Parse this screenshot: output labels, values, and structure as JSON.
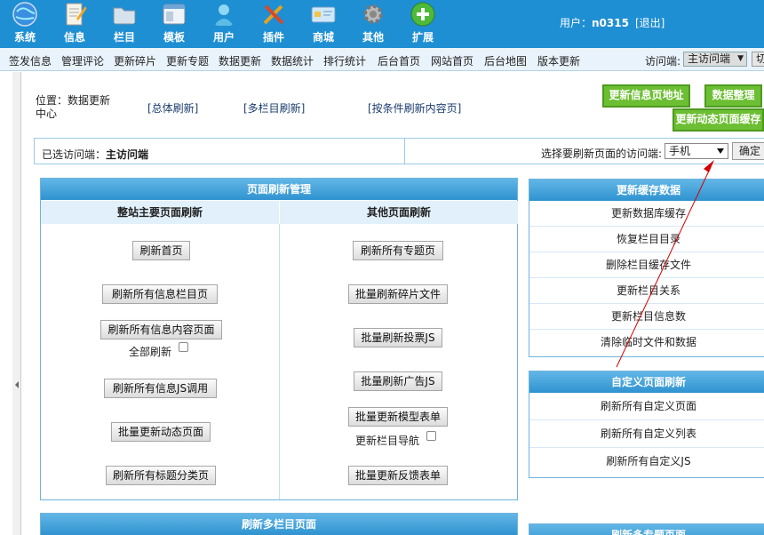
{
  "topnav": [
    {
      "label": "系统",
      "icon": "globe-icon",
      "color": "#4aa3f0"
    },
    {
      "label": "信息",
      "icon": "notepad-icon",
      "color": "#f0f0e6"
    },
    {
      "label": "栏目",
      "icon": "folder-icon",
      "color": "#c7d7e6"
    },
    {
      "label": "模板",
      "icon": "window-icon",
      "color": "#d8e8f4"
    },
    {
      "label": "用户",
      "icon": "user-icon",
      "color": "#7fd0f0"
    },
    {
      "label": "插件",
      "icon": "tools-icon",
      "color": "#f2b838"
    },
    {
      "label": "商城",
      "icon": "card-icon",
      "color": "#9fd1f5"
    },
    {
      "label": "其他",
      "icon": "gear-icon",
      "color": "#c8c8c8"
    },
    {
      "label": "扩展",
      "icon": "plus-icon",
      "color": "#4fb93a"
    }
  ],
  "user": {
    "prefix": "用户：",
    "name": "n0315",
    "logout": "[退出]"
  },
  "subnav": [
    "签发信息",
    "管理评论",
    "更新碎片",
    "更新专题",
    "数据更新",
    "数据统计",
    "排行统计",
    "后台首页",
    "网站首页",
    "后台地图",
    "版本更新"
  ],
  "visit": {
    "label": "访问端:",
    "value": "主访问端",
    "btn": "切"
  },
  "location": {
    "label": "位置：数据更新中心"
  },
  "top_links": [
    "[总体刷新]",
    "[多栏目刷新]",
    "[按条件刷新内容页]"
  ],
  "green_buttons": [
    "更新信息页地址",
    "数据整理",
    "更新动态页面缓存"
  ],
  "selected": {
    "prefix": "已选访问端：",
    "value": "主访问端",
    "choose_label": "选择要刷新页面的访问端:",
    "dropdown": "手机",
    "ok": "确定"
  },
  "refresh_panel": {
    "title": "页面刷新管理",
    "left_head": "整站主要页面刷新",
    "right_head": "其他页面刷新",
    "left_buttons": [
      "刷新首页",
      "刷新所有信息栏目页",
      "刷新所有信息内容页面",
      "刷新所有信息JS调用",
      "批量更新动态页面",
      "刷新所有标题分类页"
    ],
    "all_refresh": "全部刷新",
    "right_buttons": [
      "刷新所有专题页",
      "批量刷新碎片文件",
      "批量刷新投票JS",
      "批量刷新广告JS",
      "批量更新模型表单",
      "批量更新反馈表单"
    ],
    "nav_refresh": "更新栏目导航"
  },
  "cache_panel": {
    "title": "更新缓存数据",
    "items": [
      "更新数据库缓存",
      "恢复栏目目录",
      "删除栏目缓存文件",
      "更新栏目关系",
      "更新栏目信息数",
      "清除临时文件和数据"
    ]
  },
  "custom_panel": {
    "title": "自定义页面刷新",
    "items": [
      "刷新所有自定义页面",
      "刷新所有自定义列表",
      "刷新所有自定义JS"
    ]
  },
  "bottom_left_title": "刷新多栏目页面",
  "bottom_right_title": "刷新多专题页面",
  "colors": {
    "header": "#1f8fd3",
    "green": "#6cbe32",
    "panel_head": "#2f93d0",
    "arrow": "#d40000"
  }
}
